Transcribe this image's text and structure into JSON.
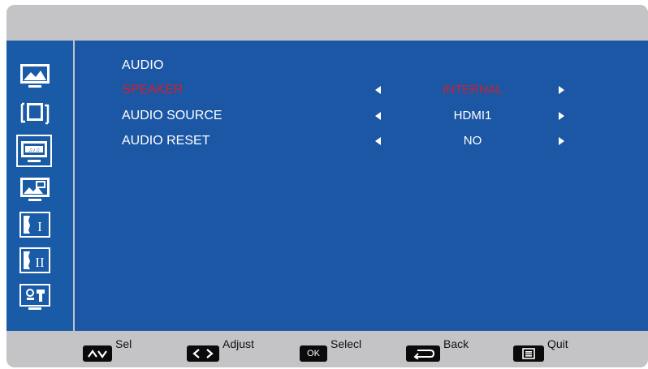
{
  "sidebar": {
    "items": [
      {
        "icon": "picture-icon",
        "active": false
      },
      {
        "icon": "screen-frame-icon",
        "active": false
      },
      {
        "icon": "audio-menu-icon",
        "active": true
      },
      {
        "icon": "picture-in-picture-icon",
        "active": false
      },
      {
        "icon": "setup-one-icon",
        "active": false
      },
      {
        "icon": "setup-two-icon",
        "active": false
      },
      {
        "icon": "option-tools-icon",
        "active": false
      }
    ]
  },
  "menu": {
    "title": "AUDIO",
    "rows": [
      {
        "label": "SPEAKER",
        "value": "INTERNAL",
        "selected": true
      },
      {
        "label": "AUDIO SOURCE",
        "value": "HDMI1",
        "selected": false
      },
      {
        "label": "AUDIO RESET",
        "value": "NO",
        "selected": false
      }
    ]
  },
  "footer": {
    "sel": {
      "key_icon": "up-down-icon",
      "label": "Sel"
    },
    "adjust": {
      "key_icon": "left-right-icon",
      "label": "Adjust"
    },
    "select": {
      "key_text": "OK",
      "label": "Selecl"
    },
    "back": {
      "key_icon": "return-icon",
      "label": "Back"
    },
    "quit": {
      "key_icon": "menu-list-icon",
      "label": "Quit"
    }
  },
  "colors": {
    "panel_blue": "#1c57a5",
    "sidebar_blue": "#1a5ba7",
    "frame_gray": "#c2c2c4",
    "selected_red": "#d11f2b",
    "text_white": "#ffffff"
  }
}
